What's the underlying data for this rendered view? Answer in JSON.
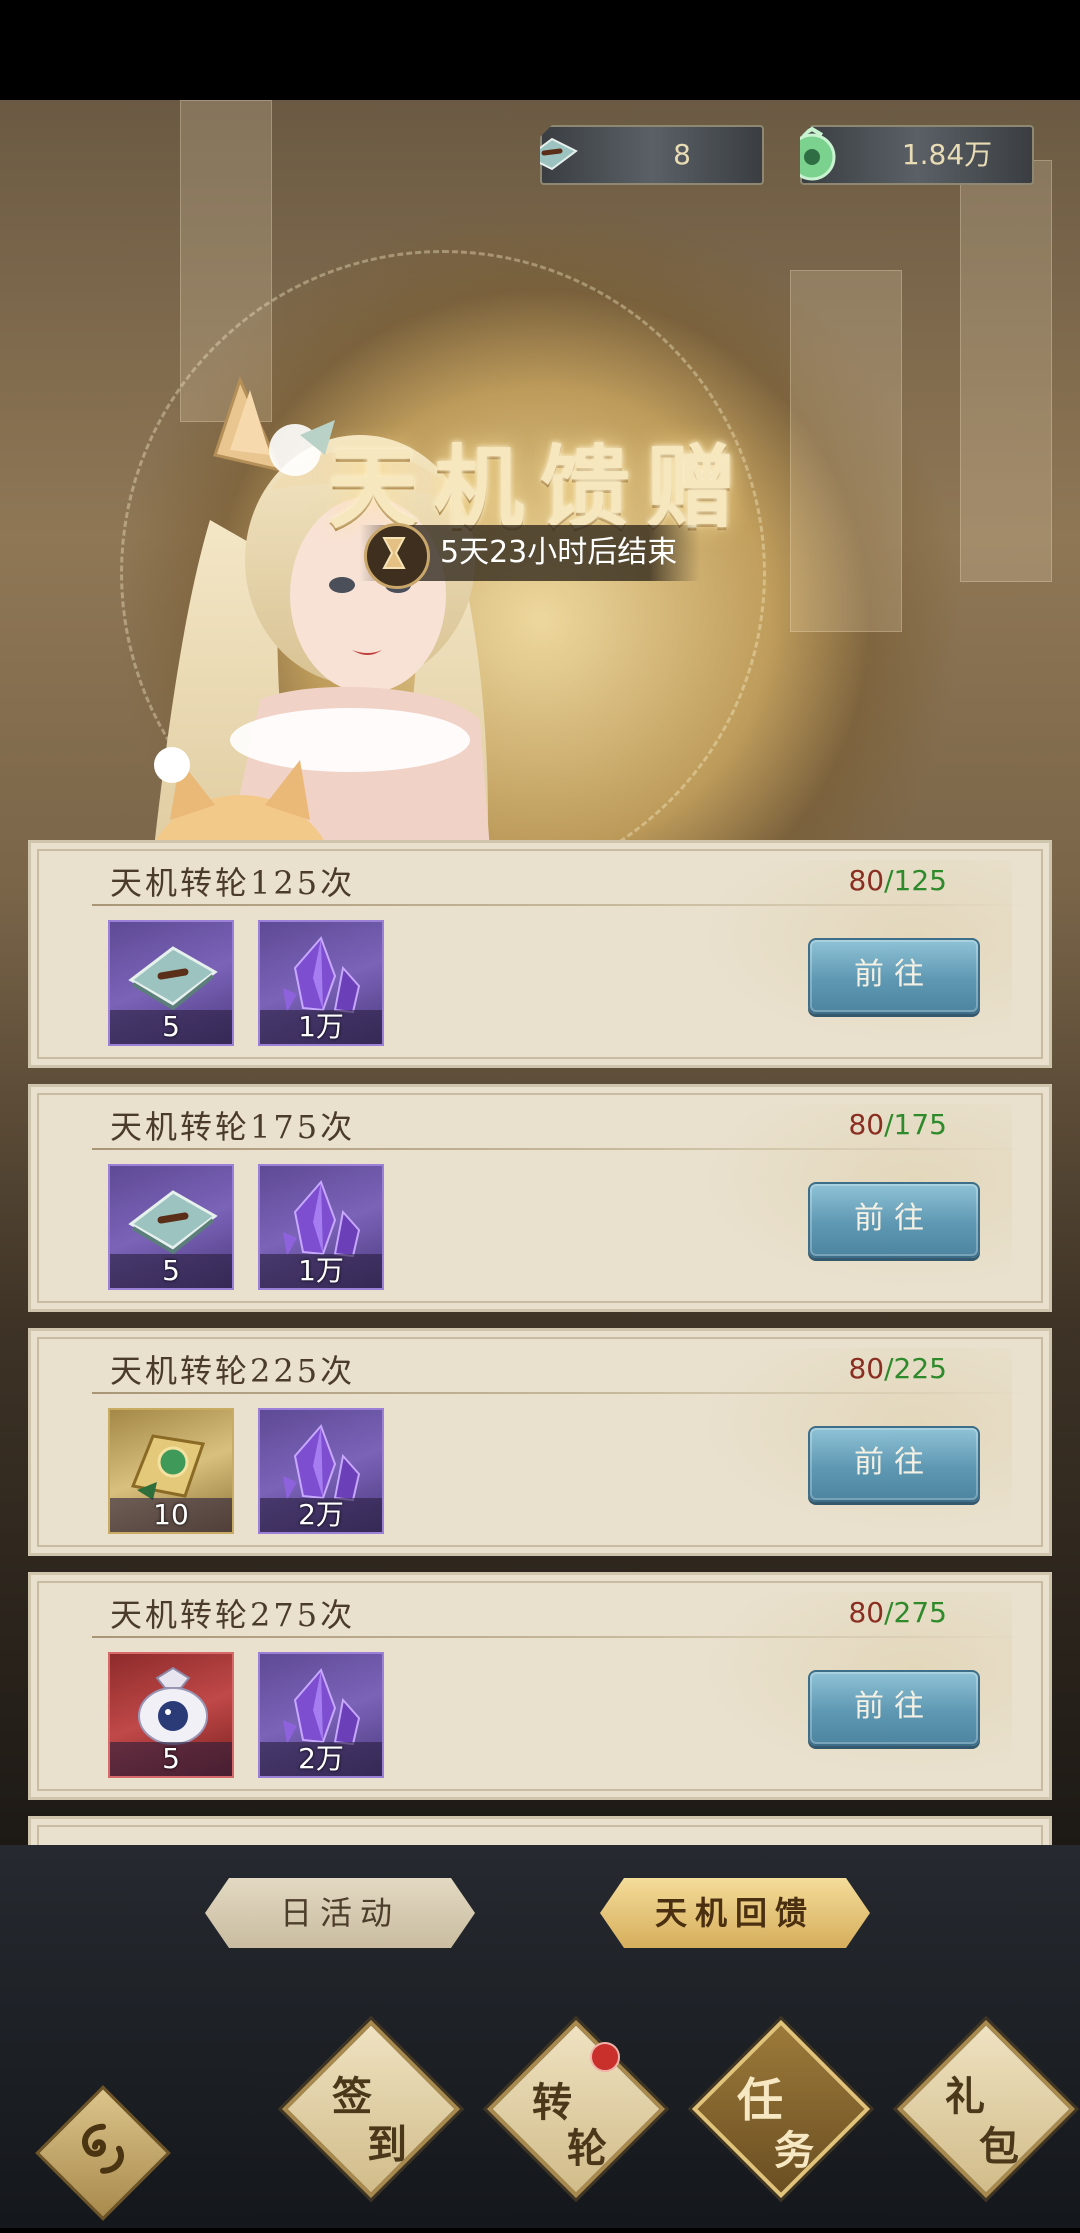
{
  "resources": [
    {
      "name": "tianji-token",
      "value": "8"
    },
    {
      "name": "jade",
      "value": "1.84万"
    }
  ],
  "event": {
    "title": "天机馈赠",
    "timer": "5天23小时后结束"
  },
  "tasks": [
    {
      "title": "天机转轮125次",
      "current": "80",
      "total": "/125",
      "rewards": [
        {
          "icon": "compass-plate-icon",
          "count": "5",
          "style": "purple"
        },
        {
          "icon": "purple-crystal-icon",
          "count": "1万",
          "style": "purple"
        }
      ],
      "button": "前往"
    },
    {
      "title": "天机转轮175次",
      "current": "80",
      "total": "/175",
      "rewards": [
        {
          "icon": "compass-plate-icon",
          "count": "5",
          "style": "purple"
        },
        {
          "icon": "purple-crystal-icon",
          "count": "1万",
          "style": "purple"
        }
      ],
      "button": "前往"
    },
    {
      "title": "天机转轮225次",
      "current": "80",
      "total": "/225",
      "rewards": [
        {
          "icon": "gold-scroll-icon",
          "count": "10",
          "style": "gold"
        },
        {
          "icon": "purple-crystal-icon",
          "count": "2万",
          "style": "purple"
        }
      ],
      "button": "前往"
    },
    {
      "title": "天机转轮275次",
      "current": "80",
      "total": "/275",
      "rewards": [
        {
          "icon": "lucky-bag-icon",
          "count": "5",
          "style": "red"
        },
        {
          "icon": "purple-crystal-icon",
          "count": "2万",
          "style": "purple"
        }
      ],
      "button": "前往"
    }
  ],
  "tabs": {
    "daily": "日活动",
    "feedback": "天机回馈"
  },
  "nav": [
    {
      "top": "签",
      "bottom": "到"
    },
    {
      "top": "转",
      "bottom": "轮"
    },
    {
      "top": "任",
      "bottom": "务"
    },
    {
      "top": "礼",
      "bottom": "包"
    }
  ],
  "colors": {
    "progress_current": "#8a2e22",
    "progress_total": "#2f8a2c",
    "go_button": "#5f98b3"
  }
}
